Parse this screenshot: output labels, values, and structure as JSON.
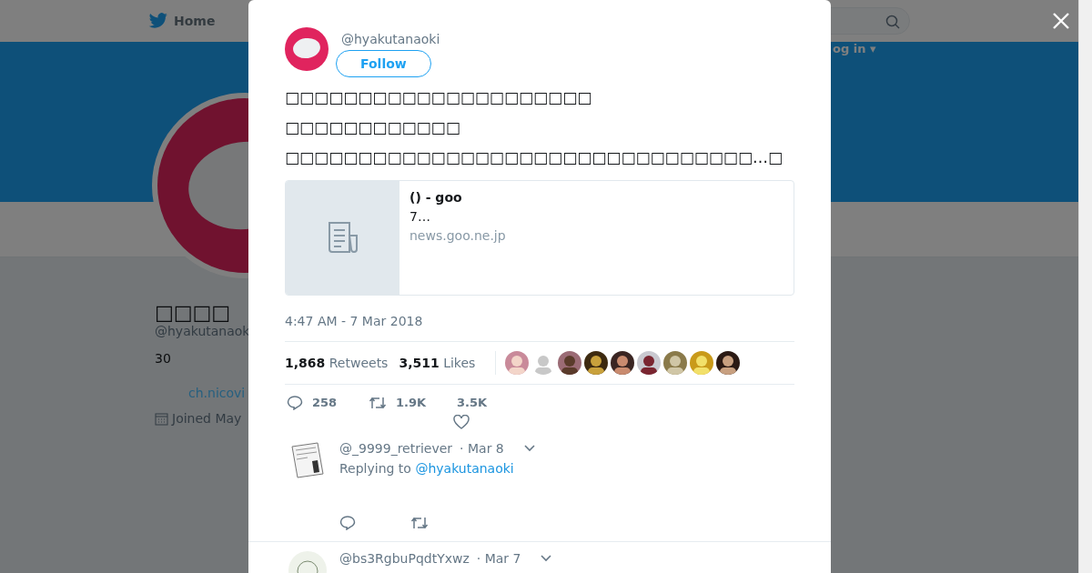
{
  "background": {
    "nav": {
      "home": "Home"
    },
    "login": "og in ▾",
    "profile": {
      "name": "□□□□",
      "handle": "@hyakutanaok",
      "bio": "30",
      "link": "ch.nicovi",
      "joined": "Joined May"
    }
  },
  "modal": {
    "author": {
      "handle": "@hyakutanaoki",
      "follow": "Follow"
    },
    "text_lines": [
      "□□□□□□□□□□□□□□□□□□□□□",
      "□□□□□□□□□□□□",
      "□□□□□□□□□□□□□□□□□□□□□□□□□□□□□□□□…□"
    ],
    "card": {
      "title": "() - goo",
      "description": "7…",
      "domain": "news.goo.ne.jp"
    },
    "timestamp": "4:47 AM - 7 Mar 2018",
    "stats": [
      {
        "count": "1,868",
        "label": "Retweets"
      },
      {
        "count": "3,511",
        "label": "Likes"
      }
    ],
    "actions": {
      "replies": "258",
      "retweets": "1.9K",
      "likes": "3.5K"
    },
    "replies": [
      {
        "handle": "@_9999_retriever",
        "date": "· Mar 8",
        "replying_label": "Replying to",
        "replying_to": "@hyakutanaoki"
      },
      {
        "handle": "@bs3RgbuPqdtYxwz",
        "date": "· Mar 7"
      }
    ]
  }
}
